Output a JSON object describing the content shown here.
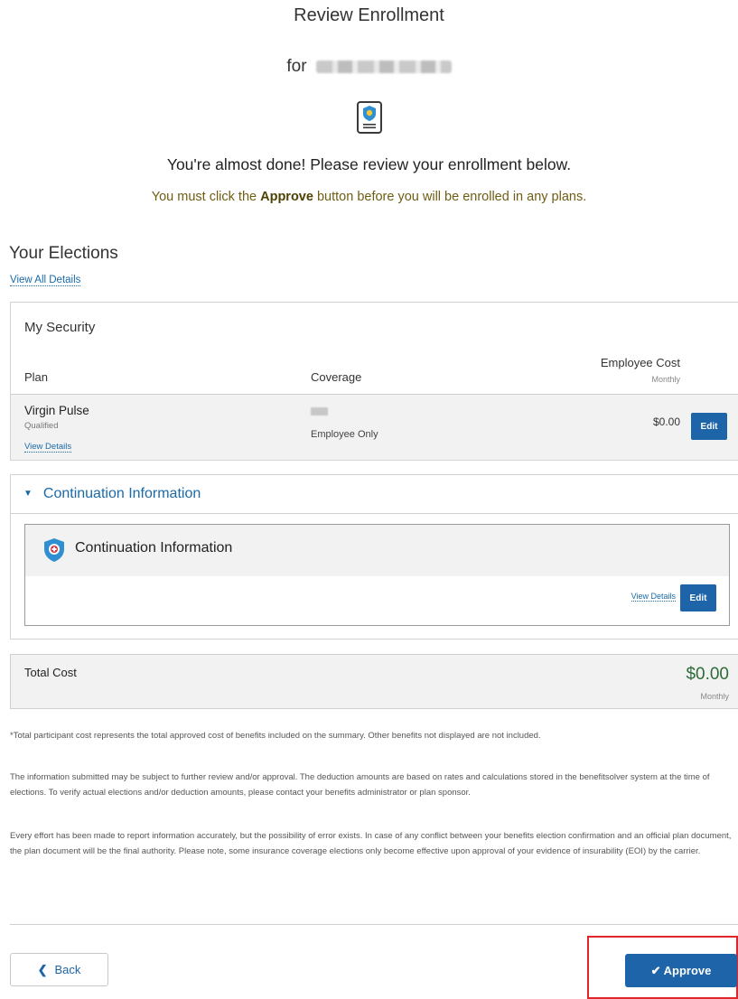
{
  "header": {
    "title": "Review Enrollment",
    "for_label": "for",
    "almost_done": "You're almost done! Please review your enrollment below.",
    "must_click_prefix": "You must click the ",
    "must_click_bold": "Approve",
    "must_click_suffix": " button before you will be enrolled in any plans.",
    "icon": "document-shield-icon"
  },
  "elections": {
    "heading": "Your Elections",
    "view_all_link": "View All Details"
  },
  "security_panel": {
    "title": "My Security",
    "columns": {
      "plan": "Plan",
      "coverage": "Coverage",
      "cost": "Employee Cost",
      "cost_period": "Monthly"
    },
    "rows": [
      {
        "plan_name": "Virgin Pulse",
        "status": "Qualified",
        "details_link": "View Details",
        "coverage": "Employee Only",
        "cost": "$0.00",
        "edit_label": "Edit"
      }
    ]
  },
  "continuation": {
    "toggle_label": "Continuation Information",
    "card_title": "Continuation Information",
    "card_icon": "shield-cross-icon",
    "details_link": "View Details",
    "edit_label": "Edit"
  },
  "total": {
    "label": "Total Cost",
    "value": "$0.00",
    "period": "Monthly",
    "value_color": "#2e6b38"
  },
  "notes": [
    "*Total participant cost represents the total approved cost of benefits included on the summary. Other benefits not displayed are not included.",
    "The information submitted may be subject to further review and/or approval. The deduction amounts are based on rates and calculations stored in the benefitsolver system at the time of elections. To verify actual elections and/or deduction amounts, please contact your benefits administrator or plan sponsor.",
    "Every effort has been made to report information accurately, but the possibility of error exists. In case of any conflict between your benefits election confirmation and an official plan document, the plan document will be the final authority. Please note, some insurance coverage elections only become effective upon approval of your evidence of insurability (EOI) by the carrier."
  ],
  "footer": {
    "back_label": "Back",
    "approve_label": "Approve"
  },
  "colors": {
    "primary_button": "#1d64a8",
    "link": "#1a6aa8",
    "highlight": "#e0262a",
    "warning_text": "#6f5d12"
  }
}
